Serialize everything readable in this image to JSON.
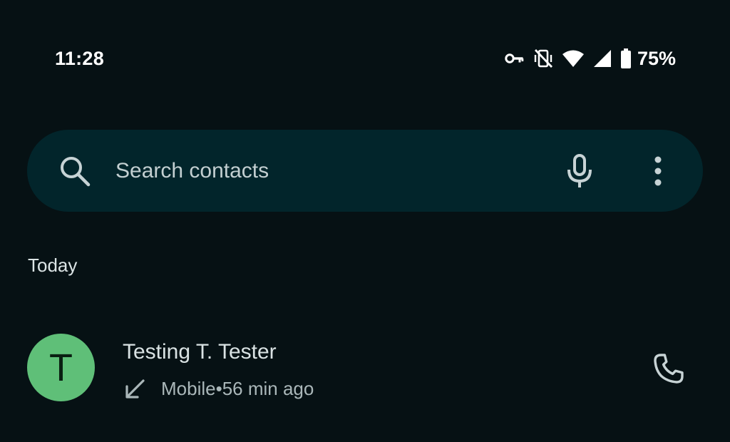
{
  "status_bar": {
    "time": "11:28",
    "battery_percent": "75%",
    "icons": [
      "vpn-key-icon",
      "vibrate-off-icon",
      "wifi-icon",
      "cellular-signal-icon",
      "battery-icon"
    ]
  },
  "search": {
    "placeholder": "Search contacts",
    "value": "",
    "icons": [
      "search-icon",
      "mic-icon",
      "more-vert-icon"
    ]
  },
  "call_log": {
    "section_title": "Today",
    "entries": [
      {
        "avatar_letter": "T",
        "name": "Testing T. Tester",
        "direction_icon": "incoming-call-arrow-icon",
        "type": "Mobile",
        "separator": "•",
        "time_ago": "56 min ago",
        "action_icon": "phone-icon"
      }
    ]
  },
  "colors": {
    "background": "#061114",
    "search_bar": "#02252b",
    "avatar": "#5fbf78",
    "primary_text": "#d9e2e3",
    "secondary_text": "#aab7b9"
  }
}
